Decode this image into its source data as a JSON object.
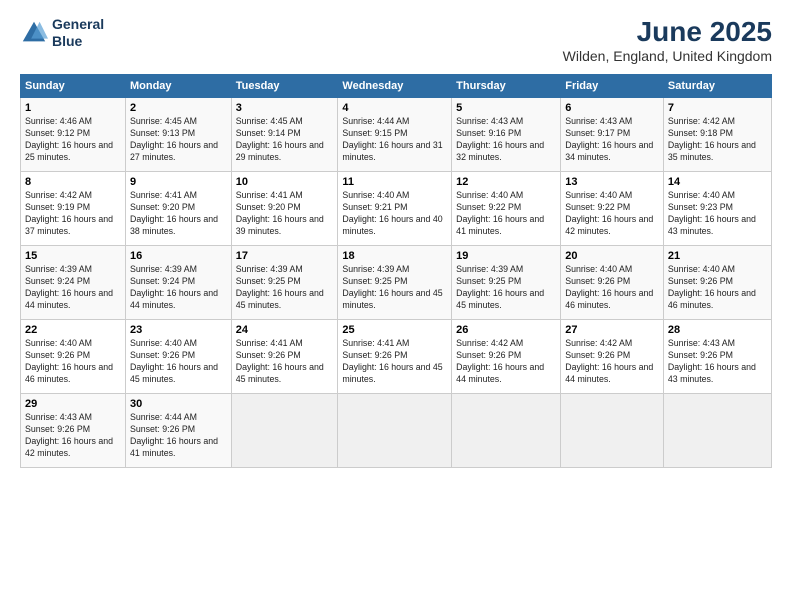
{
  "logo": {
    "line1": "General",
    "line2": "Blue"
  },
  "header": {
    "title": "June 2025",
    "subtitle": "Wilden, England, United Kingdom"
  },
  "columns": [
    "Sunday",
    "Monday",
    "Tuesday",
    "Wednesday",
    "Thursday",
    "Friday",
    "Saturday"
  ],
  "weeks": [
    [
      {
        "day": "1",
        "sunrise": "Sunrise: 4:46 AM",
        "sunset": "Sunset: 9:12 PM",
        "daylight": "Daylight: 16 hours and 25 minutes."
      },
      {
        "day": "2",
        "sunrise": "Sunrise: 4:45 AM",
        "sunset": "Sunset: 9:13 PM",
        "daylight": "Daylight: 16 hours and 27 minutes."
      },
      {
        "day": "3",
        "sunrise": "Sunrise: 4:45 AM",
        "sunset": "Sunset: 9:14 PM",
        "daylight": "Daylight: 16 hours and 29 minutes."
      },
      {
        "day": "4",
        "sunrise": "Sunrise: 4:44 AM",
        "sunset": "Sunset: 9:15 PM",
        "daylight": "Daylight: 16 hours and 31 minutes."
      },
      {
        "day": "5",
        "sunrise": "Sunrise: 4:43 AM",
        "sunset": "Sunset: 9:16 PM",
        "daylight": "Daylight: 16 hours and 32 minutes."
      },
      {
        "day": "6",
        "sunrise": "Sunrise: 4:43 AM",
        "sunset": "Sunset: 9:17 PM",
        "daylight": "Daylight: 16 hours and 34 minutes."
      },
      {
        "day": "7",
        "sunrise": "Sunrise: 4:42 AM",
        "sunset": "Sunset: 9:18 PM",
        "daylight": "Daylight: 16 hours and 35 minutes."
      }
    ],
    [
      {
        "day": "8",
        "sunrise": "Sunrise: 4:42 AM",
        "sunset": "Sunset: 9:19 PM",
        "daylight": "Daylight: 16 hours and 37 minutes."
      },
      {
        "day": "9",
        "sunrise": "Sunrise: 4:41 AM",
        "sunset": "Sunset: 9:20 PM",
        "daylight": "Daylight: 16 hours and 38 minutes."
      },
      {
        "day": "10",
        "sunrise": "Sunrise: 4:41 AM",
        "sunset": "Sunset: 9:20 PM",
        "daylight": "Daylight: 16 hours and 39 minutes."
      },
      {
        "day": "11",
        "sunrise": "Sunrise: 4:40 AM",
        "sunset": "Sunset: 9:21 PM",
        "daylight": "Daylight: 16 hours and 40 minutes."
      },
      {
        "day": "12",
        "sunrise": "Sunrise: 4:40 AM",
        "sunset": "Sunset: 9:22 PM",
        "daylight": "Daylight: 16 hours and 41 minutes."
      },
      {
        "day": "13",
        "sunrise": "Sunrise: 4:40 AM",
        "sunset": "Sunset: 9:22 PM",
        "daylight": "Daylight: 16 hours and 42 minutes."
      },
      {
        "day": "14",
        "sunrise": "Sunrise: 4:40 AM",
        "sunset": "Sunset: 9:23 PM",
        "daylight": "Daylight: 16 hours and 43 minutes."
      }
    ],
    [
      {
        "day": "15",
        "sunrise": "Sunrise: 4:39 AM",
        "sunset": "Sunset: 9:24 PM",
        "daylight": "Daylight: 16 hours and 44 minutes."
      },
      {
        "day": "16",
        "sunrise": "Sunrise: 4:39 AM",
        "sunset": "Sunset: 9:24 PM",
        "daylight": "Daylight: 16 hours and 44 minutes."
      },
      {
        "day": "17",
        "sunrise": "Sunrise: 4:39 AM",
        "sunset": "Sunset: 9:25 PM",
        "daylight": "Daylight: 16 hours and 45 minutes."
      },
      {
        "day": "18",
        "sunrise": "Sunrise: 4:39 AM",
        "sunset": "Sunset: 9:25 PM",
        "daylight": "Daylight: 16 hours and 45 minutes."
      },
      {
        "day": "19",
        "sunrise": "Sunrise: 4:39 AM",
        "sunset": "Sunset: 9:25 PM",
        "daylight": "Daylight: 16 hours and 45 minutes."
      },
      {
        "day": "20",
        "sunrise": "Sunrise: 4:40 AM",
        "sunset": "Sunset: 9:26 PM",
        "daylight": "Daylight: 16 hours and 46 minutes."
      },
      {
        "day": "21",
        "sunrise": "Sunrise: 4:40 AM",
        "sunset": "Sunset: 9:26 PM",
        "daylight": "Daylight: 16 hours and 46 minutes."
      }
    ],
    [
      {
        "day": "22",
        "sunrise": "Sunrise: 4:40 AM",
        "sunset": "Sunset: 9:26 PM",
        "daylight": "Daylight: 16 hours and 46 minutes."
      },
      {
        "day": "23",
        "sunrise": "Sunrise: 4:40 AM",
        "sunset": "Sunset: 9:26 PM",
        "daylight": "Daylight: 16 hours and 45 minutes."
      },
      {
        "day": "24",
        "sunrise": "Sunrise: 4:41 AM",
        "sunset": "Sunset: 9:26 PM",
        "daylight": "Daylight: 16 hours and 45 minutes."
      },
      {
        "day": "25",
        "sunrise": "Sunrise: 4:41 AM",
        "sunset": "Sunset: 9:26 PM",
        "daylight": "Daylight: 16 hours and 45 minutes."
      },
      {
        "day": "26",
        "sunrise": "Sunrise: 4:42 AM",
        "sunset": "Sunset: 9:26 PM",
        "daylight": "Daylight: 16 hours and 44 minutes."
      },
      {
        "day": "27",
        "sunrise": "Sunrise: 4:42 AM",
        "sunset": "Sunset: 9:26 PM",
        "daylight": "Daylight: 16 hours and 44 minutes."
      },
      {
        "day": "28",
        "sunrise": "Sunrise: 4:43 AM",
        "sunset": "Sunset: 9:26 PM",
        "daylight": "Daylight: 16 hours and 43 minutes."
      }
    ],
    [
      {
        "day": "29",
        "sunrise": "Sunrise: 4:43 AM",
        "sunset": "Sunset: 9:26 PM",
        "daylight": "Daylight: 16 hours and 42 minutes."
      },
      {
        "day": "30",
        "sunrise": "Sunrise: 4:44 AM",
        "sunset": "Sunset: 9:26 PM",
        "daylight": "Daylight: 16 hours and 41 minutes."
      },
      null,
      null,
      null,
      null,
      null
    ]
  ]
}
